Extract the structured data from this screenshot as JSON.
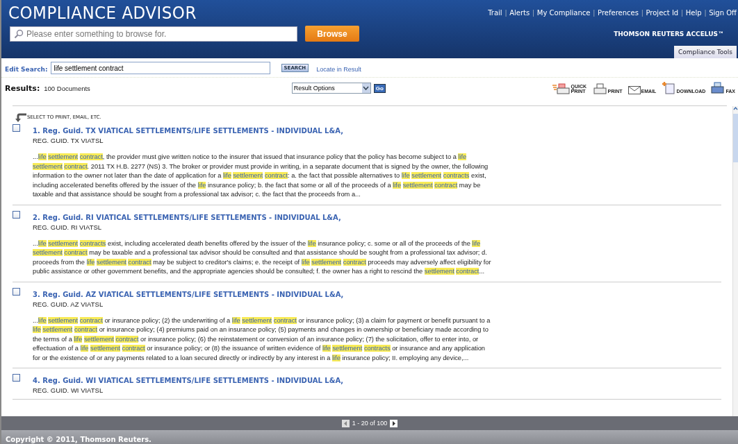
{
  "header": {
    "title": "COMPLIANCE ADVISOR",
    "browse_placeholder": "Please enter something to browse for.",
    "browse_button": "Browse",
    "nav_links": [
      "Trail",
      "Alerts",
      "My Compliance",
      "Preferences",
      "Project Id",
      "Help",
      "Sign Off"
    ],
    "nav_separator": "|",
    "brand": "THOMSON REUTERS ACCELUS™",
    "tabs": [
      {
        "label": "Compliance Tools",
        "selected": true
      }
    ]
  },
  "search_bar": {
    "label": "Edit Search:",
    "value": "life settlement contract",
    "button": "SEARCH",
    "locate_link": "Locate in Result"
  },
  "results_bar": {
    "label": "Results:",
    "count": "100 Documents",
    "options_select": "Result Options",
    "go_button": "Go",
    "tools": [
      {
        "kind": "quick-print",
        "label": "QUICK PRINT"
      },
      {
        "kind": "print",
        "label": "PRINT"
      },
      {
        "kind": "email",
        "label": "EMAIL"
      },
      {
        "kind": "download",
        "label": "DOWNLOAD"
      },
      {
        "kind": "fax",
        "label": "FAX"
      }
    ]
  },
  "select_hint": "SELECT TO PRINT, EMAIL, ETC.",
  "results": [
    {
      "title": "1. Reg. Guid. TX VIATICAL SETTLEMENTS/LIFE SETTLEMENTS - INDIVIDUAL L&A,",
      "citation": "REG. GUID. TX VIATSL",
      "checked": false,
      "snippet": "...**life** **settlement** **contract**, the provider must give written notice to the insurer that issued that insurance policy that the policy has become subject to a **life** **settlement** **contract**. 2011 TX H.B. 2277 (NS) 3. The broker or provider must provide in writing, in a separate document that is signed by the owner, the following information to the owner not later than the date of application for a **life** **settlement** **contract**: a. the fact that possible alternatives to **life** **settlement** **contracts** exist, including accelerated benefits offered by the issuer of the **life** insurance policy; b. the fact that some or all of the proceeds of a **life** **settlement** **contract** may be taxable and that assistance should be sought from a professional tax advisor; c. the fact that the proceeds from a..."
    },
    {
      "title": "2. Reg. Guid. RI VIATICAL SETTLEMENTS/LIFE SETTLEMENTS - INDIVIDUAL L&A,",
      "citation": "REG. GUID. RI VIATSL",
      "checked": false,
      "snippet": "...**life** **settlement** **contracts** exist, including accelerated death benefits offered by the issuer of the **life** insurance policy; c. some or all of the proceeds of the **life** **settlement** **contract** may be taxable and a professional tax advisor should be consulted and that assistance should be sought from a professional tax advisor; d. proceeds from the **life** **settlement** **contract** may be subject to creditor's claims; e. the receipt of **life** **settlement** **contract** proceeds may adversely affect eligibility for public assistance or other government benefits, and the appropriate agencies should be consulted; f. the owner has a right to rescind the **settlement** **contract**..."
    },
    {
      "title": "3. Reg. Guid. AZ VIATICAL SETTLEMENTS/LIFE SETTLEMENTS - INDIVIDUAL L&A,",
      "citation": "REG. GUID. AZ VIATSL",
      "checked": false,
      "snippet": "...**life** **settlement** **contract** or insurance policy; (2) the underwriting of a **life** **settlement** **contract** or insurance policy; (3) a claim for payment or benefit pursuant to a **life** **settlement** **contract** or insurance policy; (4) premiums paid on an insurance policy; (5) payments and changes in ownership or beneficiary made according to the terms of a **life** **settlement** **contract** or insurance policy; (6) the reinstatement or conversion of an insurance policy; (7) the solicitation, offer to enter into, or effectuation of a **life** **settlement** **contract** or insurance policy; or (8) the issuance of written evidence of **life** **settlement** **contracts** or insurance and any application for or the existence of or any payments related to a loan secured directly or indirectly by any interest in a **life** insurance policy; II. employing any device,..."
    },
    {
      "title": "4. Reg. Guid. WI VIATICAL SETTLEMENTS/LIFE SETTLEMENTS - INDIVIDUAL L&A,",
      "citation": "REG. GUID. WI VIATSL",
      "checked": false
    }
  ],
  "pager": {
    "range": "1 - 20 of 100"
  },
  "footer": {
    "copyright": "Copyright © 2011, Thomson Reuters."
  }
}
